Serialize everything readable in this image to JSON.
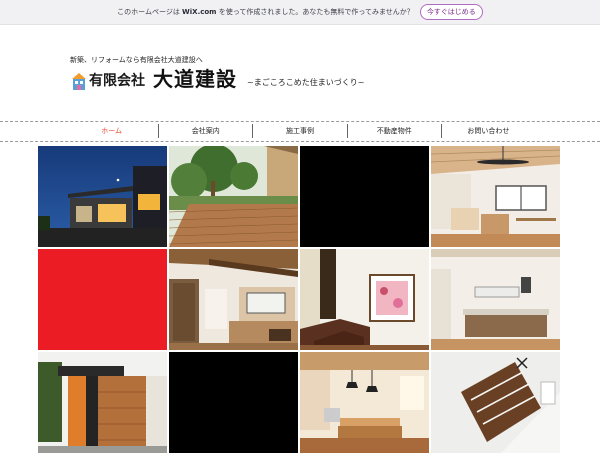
{
  "wix_banner": {
    "message_before": "このホームページは ",
    "brand": "WiX.com",
    "message_after": " を使って作成されました。あなたも無料で作ってみませんか？",
    "cta_label": "今すぐはじめる"
  },
  "header": {
    "tagline": "新築、リフォームなら有限会社大道建設へ",
    "company_type": "有限会社",
    "company_name": "大道建設",
    "slogan": "~まごころこめた住まいづくり~"
  },
  "nav": {
    "items": [
      {
        "label": "ホーム",
        "active": true
      },
      {
        "label": "会社案内",
        "active": false
      },
      {
        "label": "施工事例",
        "active": false
      },
      {
        "label": "不動産物件",
        "active": false
      },
      {
        "label": "お問い合わせ",
        "active": false
      }
    ]
  },
  "colors": {
    "active_nav": "#e8462f",
    "red_tile": "#ec1c24",
    "black_tile": "#000000",
    "wix_cta": "#b06cc0"
  }
}
